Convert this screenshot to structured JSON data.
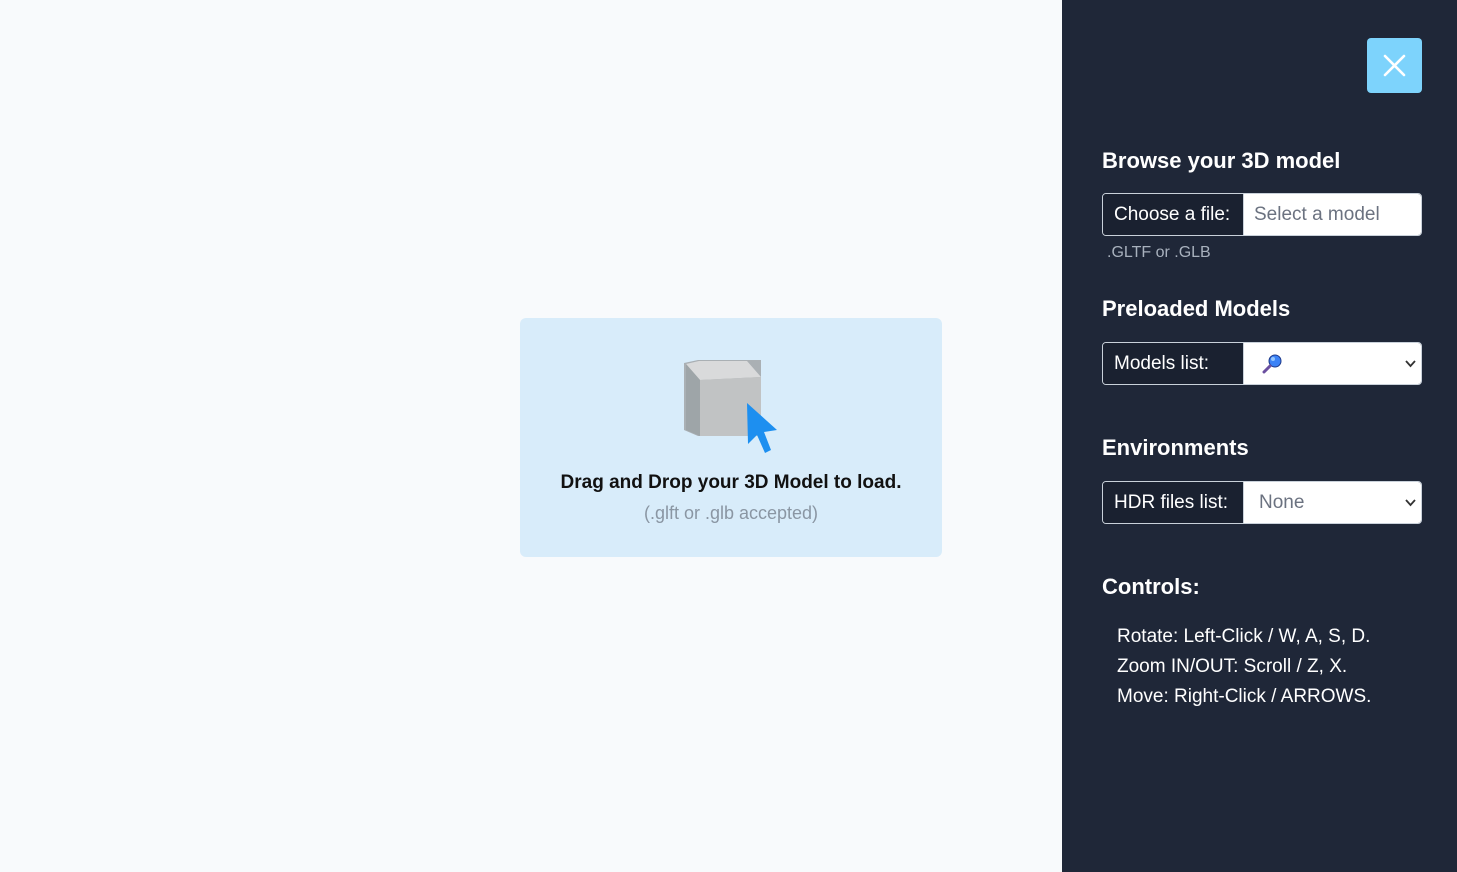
{
  "dropzone": {
    "title": "Drag and Drop your 3D Model to load.",
    "subtitle": "(.glft or .glb accepted)",
    "graphic": "cube-with-cursor-icon"
  },
  "sidebar": {
    "close_icon": "close-icon",
    "browse": {
      "title": "Browse your 3D model",
      "label": "Choose a file:",
      "placeholder": "Select a model",
      "hint": ".GLTF or .GLB"
    },
    "preloaded": {
      "title": "Preloaded Models",
      "label": "Models list:",
      "selected_icon": "magnifier-icon"
    },
    "environments": {
      "title": "Environments",
      "label": "HDR files list:",
      "selected": "None"
    },
    "controls": {
      "title": "Controls:",
      "items": [
        "Rotate: Left-Click / W, A, S, D.",
        "Zoom IN/OUT: Scroll / Z, X.",
        "Move: Right-Click / ARROWS."
      ]
    }
  },
  "colors": {
    "sidebar_bg": "#1f2738",
    "accent": "#7dd3fc",
    "dropzone_bg": "#d8ecfa",
    "cursor": "#1d8ff0"
  }
}
